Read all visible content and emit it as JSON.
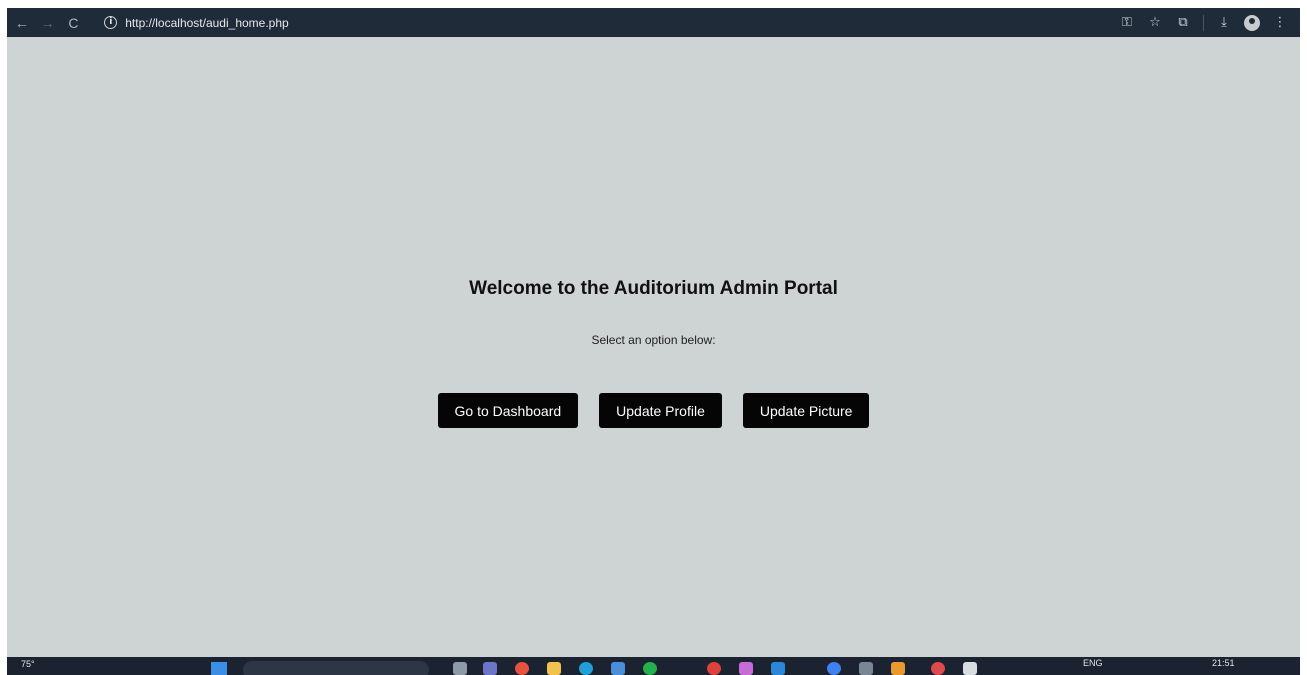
{
  "browser": {
    "url": "http://localhost/audi_home.php",
    "nav_back": "←",
    "nav_forward": "→",
    "nav_reload": "C",
    "info_glyph": "i"
  },
  "page": {
    "title": "Welcome to the Auditorium Admin Portal",
    "subtitle": "Select an option below:",
    "buttons": {
      "dashboard": "Go to Dashboard",
      "update_profile": "Update Profile",
      "update_picture": "Update Picture"
    },
    "background_color": "#ced3d4",
    "button_color": "#050505"
  },
  "taskbar": {
    "weather": "75°",
    "language": "ENG",
    "clock": "21:51"
  },
  "icons": [
    "back-arrow-icon",
    "forward-arrow-icon",
    "reload-icon",
    "info-icon",
    "key-icon",
    "star-icon",
    "extensions-icon",
    "download-icon",
    "profile-icon",
    "menu-dots-icon",
    "windows-start-icon",
    "search-icon"
  ]
}
